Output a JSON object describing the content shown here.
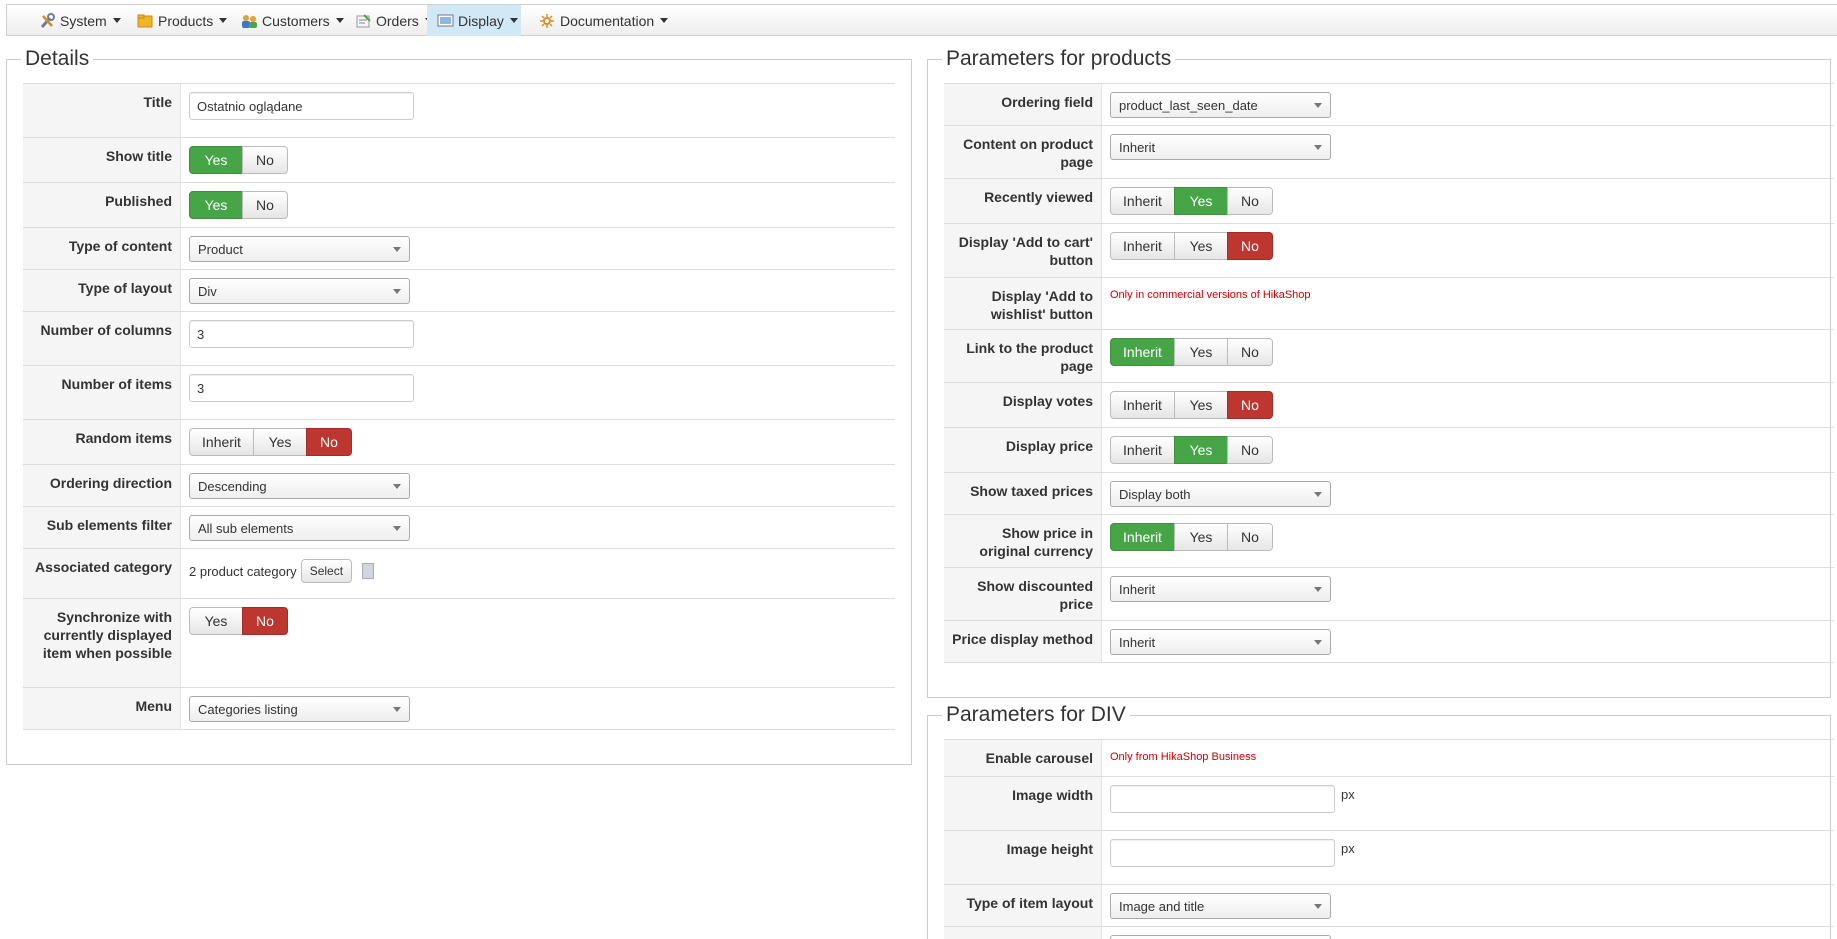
{
  "nav": {
    "items": [
      {
        "label": "System",
        "icon": "tools-icon"
      },
      {
        "label": "Products",
        "icon": "folder-icon"
      },
      {
        "label": "Customers",
        "icon": "users-icon"
      },
      {
        "label": "Orders",
        "icon": "orders-icon"
      },
      {
        "label": "Display",
        "icon": "display-icon"
      },
      {
        "label": "Documentation",
        "icon": "documentation-icon"
      }
    ],
    "active": "Display"
  },
  "details": {
    "legend": "Details",
    "title_label": "Title",
    "title_value": "Ostatnio oglądane",
    "show_title_label": "Show title",
    "published_label": "Published",
    "type_of_content_label": "Type of content",
    "type_of_content_value": "Product",
    "type_of_layout_label": "Type of layout",
    "type_of_layout_value": "Div",
    "number_of_columns_label": "Number of columns",
    "number_of_columns_value": "3",
    "number_of_items_label": "Number of items",
    "number_of_items_value": "3",
    "random_items_label": "Random items",
    "ordering_direction_label": "Ordering direction",
    "ordering_direction_value": "Descending",
    "sub_elements_filter_label": "Sub elements filter",
    "sub_elements_filter_value": "All sub elements",
    "associated_category_label": "Associated category",
    "associated_category_value": "2 product category",
    "select_button": "Select",
    "synchronize_label": "Synchronize with currently displayed item when possible",
    "menu_label": "Menu",
    "menu_value": "Categories listing"
  },
  "buttons": {
    "yes": "Yes",
    "no": "No",
    "inherit": "Inherit"
  },
  "products": {
    "legend": "Parameters for products",
    "ordering_field_label": "Ordering field",
    "ordering_field_value": "product_last_seen_date",
    "content_on_product_page_label": "Content on product page",
    "content_on_product_page_value": "Inherit",
    "recently_viewed_label": "Recently viewed",
    "add_to_cart_label": "Display 'Add to cart' button",
    "add_to_wishlist_label": "Display 'Add to wishlist' button",
    "add_to_wishlist_note": "Only in commercial versions of HikaShop",
    "link_to_product_label": "Link to the product page",
    "display_votes_label": "Display votes",
    "display_price_label": "Display price",
    "show_taxed_prices_label": "Show taxed prices",
    "show_taxed_prices_value": "Display both",
    "show_price_original_label": "Show price in original currency",
    "show_discounted_label": "Show discounted price",
    "show_discounted_value": "Inherit",
    "price_display_method_label": "Price display method",
    "price_display_method_value": "Inherit"
  },
  "div": {
    "legend": "Parameters for DIV",
    "enable_carousel_label": "Enable carousel",
    "enable_carousel_note": "Only from HikaShop Business",
    "image_width_label": "Image width",
    "image_width_value": "",
    "image_height_label": "Image height",
    "image_height_value": "",
    "px_unit": "px",
    "type_of_item_layout_label": "Type of item layout",
    "type_of_item_layout_value": "Image and title"
  },
  "colors": {
    "yes_active": "#46a546",
    "no_active": "#bd362f",
    "nav_active": "#d1e8f7",
    "note": "#cc0000"
  }
}
